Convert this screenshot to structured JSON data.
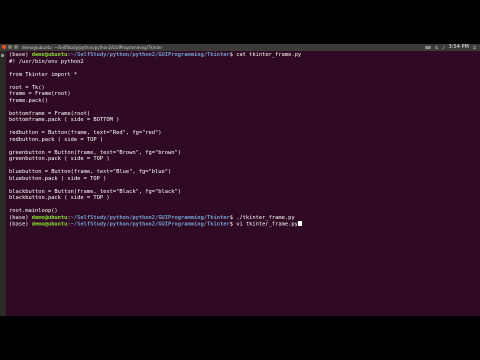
{
  "colors": {
    "terminal_bg": "#300a24",
    "user_host": "#8ae234",
    "path": "#729fcf",
    "text": "#ffffff",
    "close_button": "#e9541f"
  },
  "topbar": {
    "title": "demo@ubuntu: ~/SelfStudy/python/python2/GUIProgramming/Tkinter",
    "clock": "3:54 PM",
    "indicator_icons": [
      "keyboard-icon",
      "network-icon",
      "volume-icon",
      "power-icon"
    ]
  },
  "terminal": {
    "lines": [
      {
        "segments": [
          {
            "t": "plain",
            "v": "(base) "
          },
          {
            "t": "user",
            "v": "demo@ubuntu"
          },
          {
            "t": "plain",
            "v": ":"
          },
          {
            "t": "path",
            "v": "~/SelfStudy/python/python2/GUIProgramming/Tkinter"
          },
          {
            "t": "plain",
            "v": "$ cat tkinter_frame.py"
          }
        ]
      },
      {
        "segments": [
          {
            "t": "plain",
            "v": "#! /usr/bin/env python2"
          }
        ]
      },
      {
        "segments": [
          {
            "t": "plain",
            "v": ""
          }
        ]
      },
      {
        "segments": [
          {
            "t": "plain",
            "v": "from Tkinter import *"
          }
        ]
      },
      {
        "segments": [
          {
            "t": "plain",
            "v": ""
          }
        ]
      },
      {
        "segments": [
          {
            "t": "plain",
            "v": "root = Tk()"
          }
        ]
      },
      {
        "segments": [
          {
            "t": "plain",
            "v": "frame = Frame(root)"
          }
        ]
      },
      {
        "segments": [
          {
            "t": "plain",
            "v": "frame.pack()"
          }
        ]
      },
      {
        "segments": [
          {
            "t": "plain",
            "v": ""
          }
        ]
      },
      {
        "segments": [
          {
            "t": "plain",
            "v": "bottomframe = Frame(root)"
          }
        ]
      },
      {
        "segments": [
          {
            "t": "plain",
            "v": "bottomframe.pack ( side = BOTTOM )"
          }
        ]
      },
      {
        "segments": [
          {
            "t": "plain",
            "v": ""
          }
        ]
      },
      {
        "segments": [
          {
            "t": "plain",
            "v": "redbutton = Button(frame, text=\"Red\", fg=\"red\")"
          }
        ]
      },
      {
        "segments": [
          {
            "t": "plain",
            "v": "redbutton.pack ( side = TOP )"
          }
        ]
      },
      {
        "segments": [
          {
            "t": "plain",
            "v": ""
          }
        ]
      },
      {
        "segments": [
          {
            "t": "plain",
            "v": "greenbutton = Button(frame, text=\"Brown\", fg=\"brown\")"
          }
        ]
      },
      {
        "segments": [
          {
            "t": "plain",
            "v": "greenbutton.pack ( side = TOP )"
          }
        ]
      },
      {
        "segments": [
          {
            "t": "plain",
            "v": ""
          }
        ]
      },
      {
        "segments": [
          {
            "t": "plain",
            "v": "bluebutton = Button(frame, text=\"Blue\", fg=\"blue\")"
          }
        ]
      },
      {
        "segments": [
          {
            "t": "plain",
            "v": "bluebutton.pack ( side = TOP )"
          }
        ]
      },
      {
        "segments": [
          {
            "t": "plain",
            "v": ""
          }
        ]
      },
      {
        "segments": [
          {
            "t": "plain",
            "v": "blackbutton = Button(frame, text=\"Black\", fg=\"black\")"
          }
        ]
      },
      {
        "segments": [
          {
            "t": "plain",
            "v": "blackbutton.pack ( side = TOP )"
          }
        ]
      },
      {
        "segments": [
          {
            "t": "plain",
            "v": ""
          }
        ]
      },
      {
        "segments": [
          {
            "t": "plain",
            "v": "root.mainloop()"
          }
        ]
      },
      {
        "segments": [
          {
            "t": "plain",
            "v": "(base) "
          },
          {
            "t": "user",
            "v": "demo@ubuntu"
          },
          {
            "t": "plain",
            "v": ":"
          },
          {
            "t": "path",
            "v": "~/SelfStudy/python/python2/GUIProgramming/Tkinter"
          },
          {
            "t": "plain",
            "v": "$ ./tkinter_frame.py"
          }
        ]
      },
      {
        "segments": [
          {
            "t": "plain",
            "v": "(base) "
          },
          {
            "t": "user",
            "v": "demo@ubuntu"
          },
          {
            "t": "plain",
            "v": ":"
          },
          {
            "t": "path",
            "v": "~/SelfStudy/python/python2/GUIProgramming/Tkinter"
          },
          {
            "t": "plain",
            "v": "$ vi tkinter_frame.py"
          }
        ],
        "cursor": true
      }
    ]
  }
}
